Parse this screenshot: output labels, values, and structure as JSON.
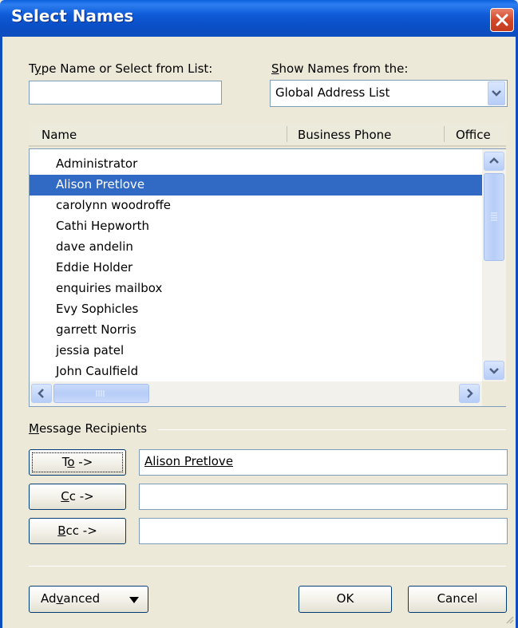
{
  "window": {
    "title": "Select Names"
  },
  "search": {
    "label_pre": "T",
    "label_key": "y",
    "label_post": "pe Name or Select from List:",
    "value": ""
  },
  "show_names": {
    "label_key": "S",
    "label_post": "how Names from the:",
    "selected": "Global Address List"
  },
  "list": {
    "columns": [
      "Name",
      "Business Phone",
      "Office"
    ],
    "rows": [
      "Administrator",
      "Alison Pretlove",
      "carolynn woodroffe",
      "Cathi Hepworth",
      "dave andelin",
      "Eddie Holder",
      "enquiries mailbox",
      "Evy Sophicles",
      "garrett Norris",
      "jessia patel",
      "John Caulfield"
    ],
    "selected_index": 1
  },
  "recipients": {
    "group_label_key": "M",
    "group_label_post": "essage Recipients",
    "to": {
      "pre": "T",
      "key": "o",
      "post": " ->",
      "value": "Alison Pretlove"
    },
    "cc": {
      "pre": "",
      "key": "C",
      "post": "c ->",
      "value": ""
    },
    "bcc": {
      "pre": "",
      "key": "B",
      "post": "cc ->",
      "value": ""
    }
  },
  "footer": {
    "advanced": {
      "pre": "Ad",
      "key": "v",
      "post": "anced"
    },
    "ok": "OK",
    "cancel": "Cancel"
  },
  "icons": [
    "close-icon",
    "dropdown-arrow-icon",
    "scroll-up-icon",
    "scroll-down-icon",
    "scroll-left-icon",
    "scroll-right-icon",
    "size-grip-icon"
  ],
  "colors": {
    "titlebar": "#0a4fc6",
    "selection": "#316ac5",
    "dialog_bg": "#ece9d8"
  }
}
